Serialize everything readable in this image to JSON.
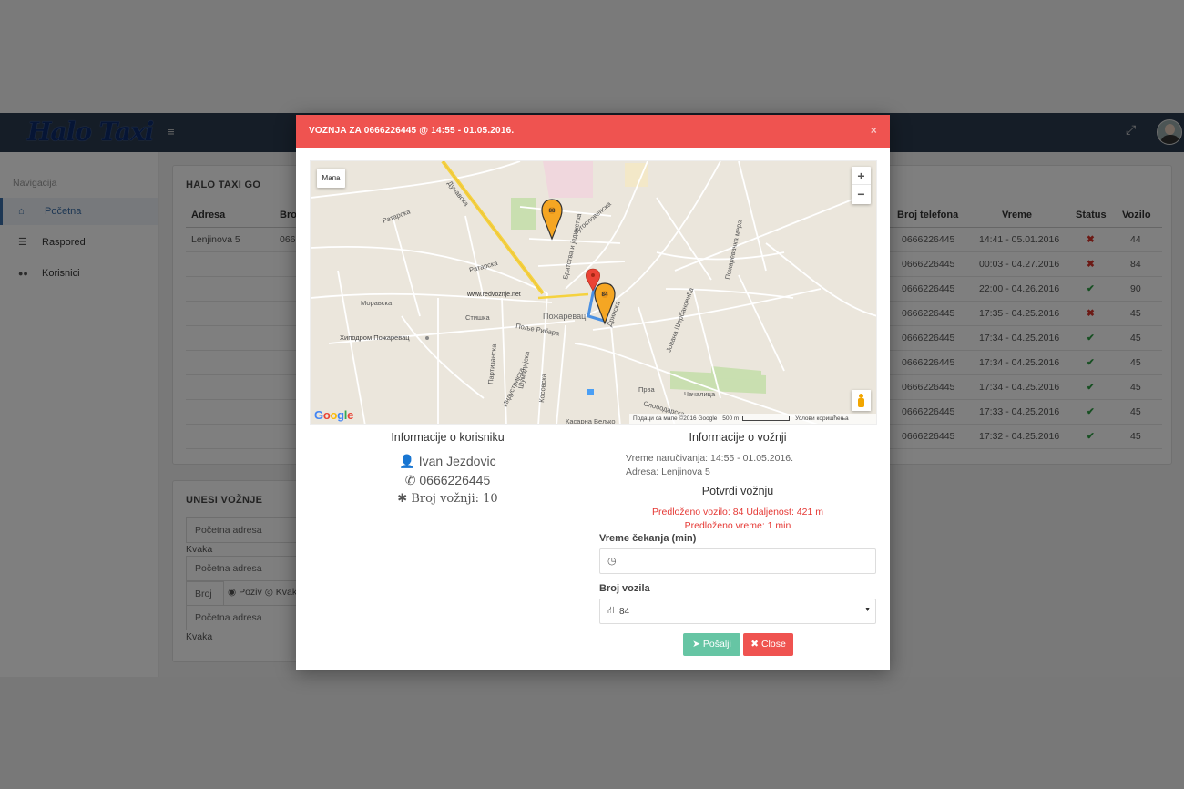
{
  "app": {
    "logo_text": "Halo Taxi",
    "hamburger_icon": "menu-icon",
    "expand_icon": "fullscreen-icon",
    "avatar": "user-avatar"
  },
  "sidebar": {
    "title": "Navigacija",
    "items": [
      {
        "label": "Početna",
        "icon": "home-icon",
        "icon_glyph": "⌂",
        "active": true
      },
      {
        "label": "Raspored",
        "icon": "list-icon",
        "icon_glyph": "☰",
        "active": false
      },
      {
        "label": "Korisnici",
        "icon": "users-icon",
        "icon_glyph": "👥",
        "active": false
      }
    ]
  },
  "rides_panel": {
    "title": "HALO TAXI GO",
    "columns": {
      "adresa": "Adresa",
      "broj": "Broj",
      "broj_telefona": "Broj telefona",
      "vreme": "Vreme",
      "status": "Status",
      "vozilo": "Vozilo"
    },
    "rows": [
      {
        "adresa": "Lenjinova 5",
        "broj": "066",
        "telefon": "0666226445",
        "vreme": "14:41 - 05.01.2016",
        "status": "✖",
        "status_ok": false,
        "vozilo": "44"
      },
      {
        "adresa": "",
        "broj": "",
        "telefon": "0666226445",
        "vreme": "00:03 - 04.27.2016",
        "status": "✖",
        "status_ok": false,
        "vozilo": "84"
      },
      {
        "adresa": "",
        "broj": "",
        "telefon": "0666226445",
        "vreme": "22:00 - 04.26.2016",
        "status": "✔",
        "status_ok": true,
        "vozilo": "90"
      },
      {
        "adresa": "",
        "broj": "",
        "telefon": "0666226445",
        "vreme": "17:35 - 04.25.2016",
        "status": "✖",
        "status_ok": false,
        "vozilo": "45"
      },
      {
        "adresa": "",
        "broj": "",
        "telefon": "0666226445",
        "vreme": "17:34 - 04.25.2016",
        "status": "✔",
        "status_ok": true,
        "vozilo": "45"
      },
      {
        "adresa": "",
        "broj": "",
        "telefon": "0666226445",
        "vreme": "17:34 - 04.25.2016",
        "status": "✔",
        "status_ok": true,
        "vozilo": "45"
      },
      {
        "adresa": "",
        "broj": "",
        "telefon": "0666226445",
        "vreme": "17:34 - 04.25.2016",
        "status": "✔",
        "status_ok": true,
        "vozilo": "45"
      },
      {
        "adresa": "",
        "broj": "",
        "telefon": "0666226445",
        "vreme": "17:33 - 04.25.2016",
        "status": "✔",
        "status_ok": true,
        "vozilo": "45"
      },
      {
        "adresa": "",
        "broj": "",
        "telefon": "0666226445",
        "vreme": "17:32 - 04.25.2016",
        "status": "✔",
        "status_ok": true,
        "vozilo": "45"
      }
    ]
  },
  "entry_panel": {
    "title": "UNESI VOŽNJE",
    "start_placeholder_1": "Početna adresa",
    "label_1": "Kvaka",
    "start_placeholder_2": "Početna adresa",
    "broj_placeholder": "Broj",
    "radio_poziv": "Poziv",
    "radio_kvaka": "Kvak",
    "start_placeholder_3": "Početna adresa",
    "label_2": "Kvaka"
  },
  "modal": {
    "title": "VOZNJA ZA 0666226445 @ 14:55 - 01.05.2016.",
    "close_glyph": "×",
    "map": {
      "type_button": "Мапа",
      "zoom_in": "+",
      "zoom_out": "−",
      "google_logo": "Google",
      "attribution": "Подаци са мапе ©2016 Google",
      "scale": "500 m",
      "terms": "Услови коришћења",
      "labels": [
        "Дунавска",
        "Ратарска",
        "Моравска",
        "Стишка",
        "www.redvoznje.net",
        "Пожаревац",
        "Хиподром Пожаревац",
        "Поље Рибара",
        "Чачалица",
        "Слободарска",
        "Касарна Вељко",
        "Прва",
        "Шумадијска",
        "Партизанска",
        "Братства и јединства",
        "Југословенска",
        "Косовска",
        "Индустријска",
        "Дринска",
        "Јована Шербановића",
        "Пожаревачка мера"
      ],
      "pins": [
        {
          "label": "88",
          "color": "#f5a623"
        },
        {
          "label": "84",
          "color": "#f5a623"
        }
      ]
    },
    "user_info": {
      "title": "Informacije o korisniku",
      "name": "Ivan Jezdovic",
      "phone": "0666226445",
      "rides_label": "Broj vožnji: 10"
    },
    "ride_info": {
      "title": "Informacije o vožnji",
      "order_time": "Vreme naručivanja: 14:55 - 01.05.2016.",
      "address": "Adresa: Lenjinova 5"
    },
    "confirm": {
      "title": "Potvrdi vožnju",
      "suggested_vehicle": "Predloženo vozilo: 84 Udaljenost: 421 m",
      "suggested_time": "Predloženo vreme: 1 min",
      "wait_label": "Vreme čekanja (min)",
      "wait_value": "",
      "vehicle_label": "Broj vozila",
      "vehicle_value": "84",
      "send_button": "Pošalji",
      "close_button": "Close"
    }
  }
}
